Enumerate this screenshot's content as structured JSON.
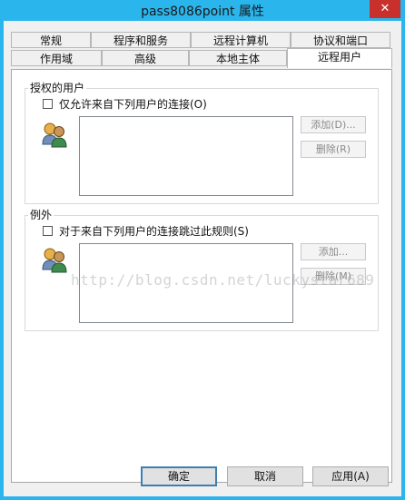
{
  "window": {
    "title": "pass8086point 属性",
    "close_glyph": "✕"
  },
  "tabs_row1": [
    "常规",
    "程序和服务",
    "远程计算机",
    "协议和端口"
  ],
  "tabs_row2": [
    "作用域",
    "高级",
    "本地主体",
    "远程用户"
  ],
  "active_tab": "远程用户",
  "authorized": {
    "title": "授权的用户",
    "checkbox_label": "仅允许来自下列用户的连接(O)",
    "checked": false,
    "add_label": "添加(D)...",
    "remove_label": "删除(R)"
  },
  "exceptions": {
    "title": "例外",
    "checkbox_label": "对于来自下列用户的连接跳过此规则(S)",
    "checked": false,
    "add_label": "添加...",
    "remove_label": "删除(M)"
  },
  "watermark": "http://blog.csdn.net/luckystar689",
  "footer": {
    "ok": "确定",
    "cancel": "取消",
    "apply": "应用(A)"
  }
}
